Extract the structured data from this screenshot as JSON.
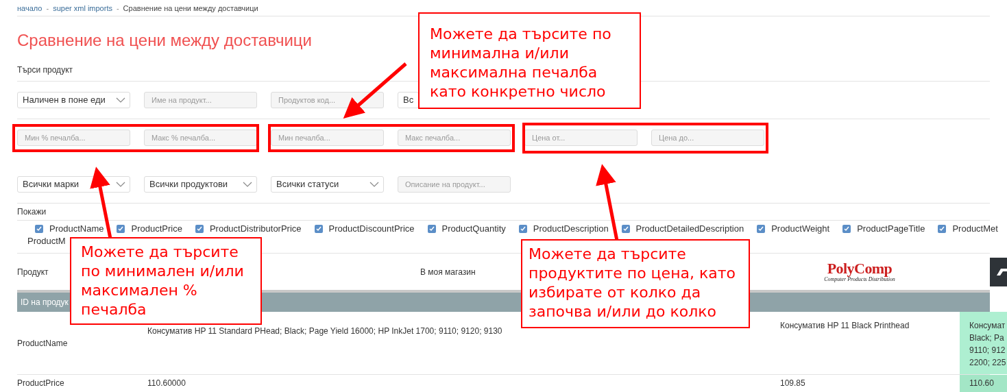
{
  "breadcrumb": {
    "items": [
      {
        "label": "начало",
        "link": true
      },
      {
        "label": "super xml imports",
        "link": true
      },
      {
        "label": "Сравнение на цени между доставчици",
        "link": false
      }
    ],
    "separator": "-"
  },
  "title": "Сравнение на цени между доставчици",
  "search_label": "Търси продукт",
  "filter_rows": [
    [
      {
        "kind": "select",
        "value": "Наличен в поне еди"
      },
      {
        "kind": "input",
        "placeholder": "Име на продукт..."
      },
      {
        "kind": "input",
        "placeholder": "Продуктов код..."
      },
      {
        "kind": "select",
        "value": "Вс"
      }
    ],
    [
      {
        "kind": "input",
        "placeholder": "Мин % печалба..."
      },
      {
        "kind": "input",
        "placeholder": "Макс % печалба..."
      },
      {
        "kind": "input",
        "placeholder": "Мин печалба..."
      },
      {
        "kind": "input",
        "placeholder": "Макс печалба..."
      },
      {
        "kind": "input",
        "placeholder": "Цена от..."
      },
      {
        "kind": "input",
        "placeholder": "Цена до..."
      }
    ],
    [
      {
        "kind": "select",
        "value": "Всички марки"
      },
      {
        "kind": "select",
        "value": "Всички продуктови"
      },
      {
        "kind": "select",
        "value": "Всички статуси"
      },
      {
        "kind": "input",
        "placeholder": "Описание на продукт..."
      }
    ]
  ],
  "show_label": "Покажи",
  "columns_toggle": [
    {
      "label": "ProductName",
      "checked": true
    },
    {
      "label": "ProductPrice",
      "checked": true
    },
    {
      "label": "ProductDistributorPrice",
      "checked": true
    },
    {
      "label": "ProductDiscountPrice",
      "checked": true
    },
    {
      "label": "ProductQuantity",
      "checked": true
    },
    {
      "label": "ProductDescription",
      "checked": true
    },
    {
      "label": "ProductDetailedDescription",
      "checked": true
    },
    {
      "label": "ProductWeight",
      "checked": true
    },
    {
      "label": "ProductPageTitle",
      "checked": true
    },
    {
      "label": "ProductMet",
      "checked": true
    }
  ],
  "wrapped_label": "ProductM",
  "table": {
    "header": {
      "label": "Продукт",
      "my_store": "В моя магазин",
      "supplier_logo": {
        "name": "PolyComp",
        "tagline": "Computer Products Distribution"
      }
    },
    "group_bar": "ID на продук",
    "rows": [
      {
        "label": "ProductName",
        "my_store": "Консуматив HP 11 Standard PHead; Black; Page Yield 16000; HP InkJet 1700; 9110; 9120; 9130",
        "supplier": "Консуматив HP 11 Black Printhead",
        "column_4": [
          "Консумат",
          "Black; Pa",
          "9110; 912",
          "2200; 225"
        ]
      },
      {
        "label": "ProductPrice",
        "my_store": "110.60000",
        "supplier": "109.85",
        "column_4": [
          "110.60"
        ]
      }
    ]
  },
  "callouts": [
    {
      "text": "Можете да търсите по минимална и/или максимална печалба като конкретно число"
    },
    {
      "text": "Можете да търсите по минимален и/или максимален % печалба"
    },
    {
      "text": "Можете да търсите продуктите по цена, като избирате от колко да започва и/или до колко"
    }
  ]
}
